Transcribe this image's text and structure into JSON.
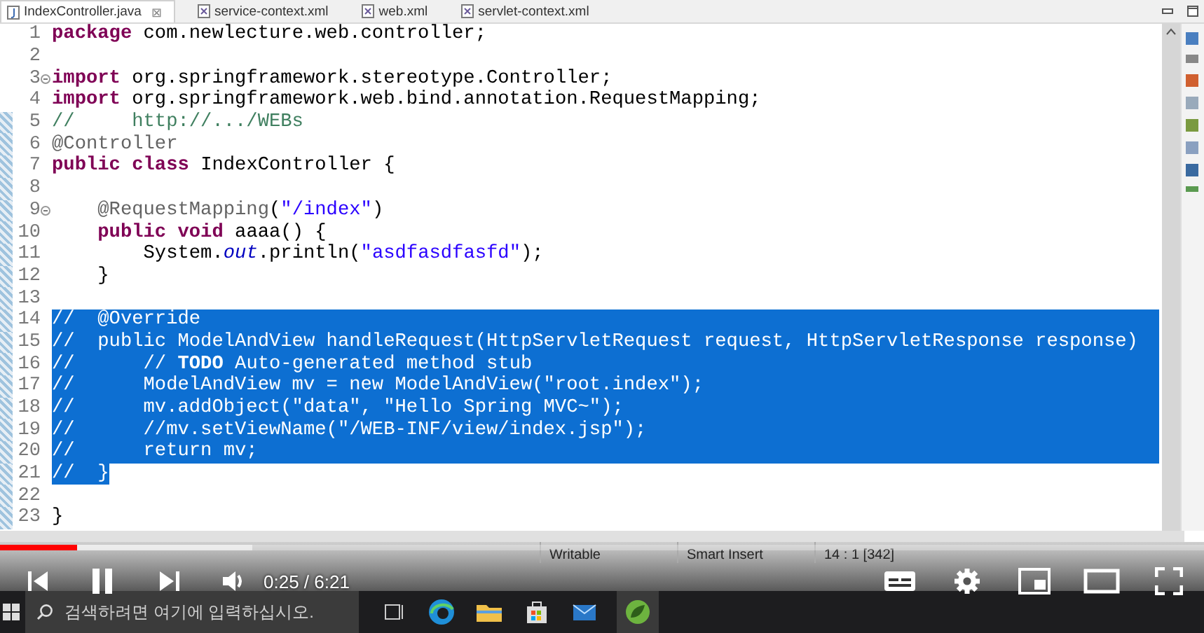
{
  "tabs": [
    {
      "label": "IndexController.java",
      "kind": "java",
      "selected": true,
      "close": "⊠"
    },
    {
      "label": "service-context.xml",
      "kind": "xml",
      "selected": false
    },
    {
      "label": "web.xml",
      "kind": "xml",
      "selected": false
    },
    {
      "label": "servlet-context.xml",
      "kind": "xml",
      "selected": false
    }
  ],
  "editor": {
    "lines": [
      {
        "number": "1",
        "changed": false,
        "fold": false,
        "selected": false,
        "tokens": [
          {
            "kind": "keyword",
            "text": "package"
          },
          {
            "kind": "plain",
            "text": " com.newlecture.web.controller;"
          }
        ]
      },
      {
        "number": "2",
        "changed": false,
        "fold": false,
        "selected": false
      },
      {
        "number": "3",
        "changed": false,
        "fold": true,
        "selected": false,
        "tokens": [
          {
            "kind": "keyword",
            "text": "import"
          },
          {
            "kind": "plain",
            "text": " org.springframework.stereotype.Controller;"
          }
        ]
      },
      {
        "number": "4",
        "changed": false,
        "fold": false,
        "selected": false,
        "tokens": [
          {
            "kind": "keyword",
            "text": "import"
          },
          {
            "kind": "plain",
            "text": " org.springframework.web.bind.annotation.RequestMapping;"
          }
        ]
      },
      {
        "number": "5",
        "changed": true,
        "fold": false,
        "selected": false,
        "tokens": [
          {
            "kind": "comment",
            "text": "//     http://.../WEBs"
          }
        ]
      },
      {
        "number": "6",
        "changed": true,
        "fold": false,
        "selected": false,
        "tokens": [
          {
            "kind": "annotation",
            "text": "@Controller"
          }
        ]
      },
      {
        "number": "7",
        "changed": true,
        "fold": false,
        "selected": false,
        "tokens": [
          {
            "kind": "keyword",
            "text": "public class"
          },
          {
            "kind": "plain",
            "text": " IndexController {"
          }
        ]
      },
      {
        "number": "8",
        "changed": true,
        "fold": false,
        "selected": false
      },
      {
        "number": "9",
        "changed": true,
        "fold": true,
        "selected": false,
        "tokens": [
          {
            "kind": "annotation",
            "text": "    @RequestMapping"
          },
          {
            "kind": "plain",
            "text": "("
          },
          {
            "kind": "string",
            "text": "\"/index\""
          },
          {
            "kind": "plain",
            "text": ")"
          }
        ]
      },
      {
        "number": "10",
        "changed": true,
        "fold": false,
        "selected": false,
        "tokens": [
          {
            "kind": "keyword",
            "text": "    public void"
          },
          {
            "kind": "plain",
            "text": " aaaa() {"
          }
        ]
      },
      {
        "number": "11",
        "changed": true,
        "fold": false,
        "selected": false,
        "tokens": [
          {
            "kind": "plain",
            "text": "        System."
          },
          {
            "kind": "field",
            "text": "out"
          },
          {
            "kind": "plain",
            "text": ".println("
          },
          {
            "kind": "string",
            "text": "\"asdfasdfasfd\""
          },
          {
            "kind": "plain",
            "text": ");"
          }
        ]
      },
      {
        "number": "12",
        "changed": true,
        "fold": false,
        "selected": false,
        "tokens": [
          {
            "kind": "plain",
            "text": "    }"
          }
        ]
      },
      {
        "number": "13",
        "changed": true,
        "fold": false,
        "selected": false
      },
      {
        "number": "14",
        "changed": true,
        "fold": false,
        "selected": true,
        "tokens": [
          {
            "kind": "comment",
            "text": "//  @Override"
          }
        ]
      },
      {
        "number": "15",
        "changed": true,
        "fold": false,
        "selected": true,
        "tokens": [
          {
            "kind": "comment",
            "text": "//  public ModelAndView handleRequest(HttpServletRequest request, HttpServletResponse response)"
          }
        ]
      },
      {
        "number": "16",
        "changed": true,
        "fold": false,
        "selected": true,
        "tokens": [
          {
            "kind": "comment",
            "text": "//      //"
          },
          {
            "kind": "todo",
            "text": " TODO"
          },
          {
            "kind": "comment",
            "text": " Auto-generated method stub"
          }
        ]
      },
      {
        "number": "17",
        "changed": true,
        "fold": false,
        "selected": true,
        "tokens": [
          {
            "kind": "comment",
            "text": "//      ModelAndView mv = new ModelAndView(\"root.index\");"
          }
        ]
      },
      {
        "number": "18",
        "changed": true,
        "fold": false,
        "selected": true,
        "tokens": [
          {
            "kind": "comment",
            "text": "//      mv.addObject(\"data\", \"Hello Spring MVC~\");"
          }
        ]
      },
      {
        "number": "19",
        "changed": true,
        "fold": false,
        "selected": true,
        "tokens": [
          {
            "kind": "comment",
            "text": "//      //mv.setViewName(\"/WEB-INF/view/index.jsp\");"
          }
        ]
      },
      {
        "number": "20",
        "changed": true,
        "fold": false,
        "selected": true,
        "tokens": [
          {
            "kind": "comment",
            "text": "//      return mv;"
          }
        ]
      },
      {
        "number": "21",
        "changed": true,
        "fold": false,
        "selected": true,
        "tokens": [
          {
            "kind": "comment",
            "text": "//  }"
          }
        ]
      },
      {
        "number": "22",
        "changed": true,
        "fold": false,
        "selected": false
      },
      {
        "number": "23",
        "changed": true,
        "fold": false,
        "selected": false,
        "tokens": [
          {
            "kind": "plain",
            "text": "}"
          }
        ]
      }
    ]
  },
  "status_bar": [
    "Writable",
    "Smart Insert",
    "14 : 1 [342]"
  ],
  "player": {
    "playing": true,
    "time": "0:25 / 6:21",
    "progress": {
      "level": 0.064
    },
    "buffer": {
      "level": 0.21
    }
  },
  "taskbar": {
    "search": {
      "placeholder": "검색하려면 여기에 입력하십시오."
    }
  }
}
